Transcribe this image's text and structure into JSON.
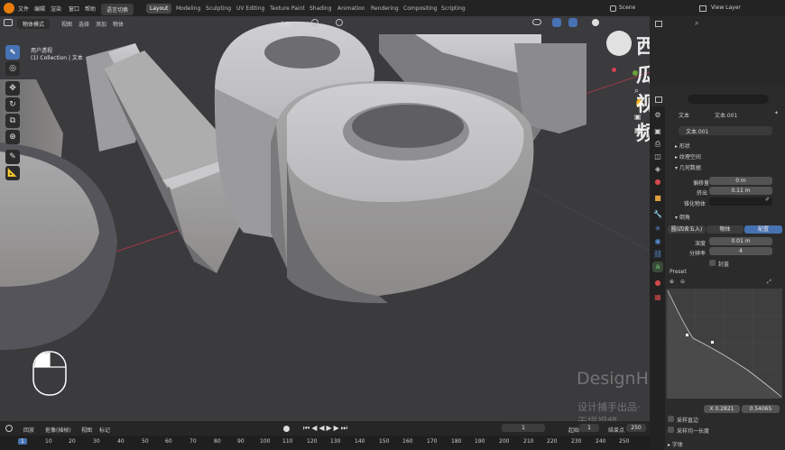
{
  "topbar": {
    "menu": [
      "文件",
      "编辑",
      "渲染",
      "窗口",
      "帮助"
    ],
    "language_button": "语言切换",
    "workspaces": [
      "Layout",
      "Modeling",
      "Sculpting",
      "UV Editing",
      "Texture Paint",
      "Shading",
      "Animation",
      "Rendering",
      "Compositing",
      "Scripting"
    ],
    "active_workspace": "Layout",
    "scene_label": "Scene",
    "view_layer_label": "View Layer"
  },
  "viewport": {
    "mode": "物体模式",
    "menus": [
      "视图",
      "选择",
      "添加",
      "物体"
    ],
    "transform_orientation": "全局",
    "overlay_title": "用户透视",
    "overlay_subtitle": "(1) Collection | 文本",
    "watermark_title": "DesignHunting",
    "watermark_sub": "设计捕手出品·无损视频",
    "logo_text": "西瓜视频",
    "bg_color": "#3b3a3d"
  },
  "timeline": {
    "menus": [
      "回放",
      "抠像(插帧)",
      "视图",
      "标记"
    ],
    "current_frame": "1",
    "start_label": "起始",
    "start_value": "1",
    "end_label": "结束点",
    "end_value": "250",
    "ruler": [
      "1",
      "10",
      "20",
      "30",
      "40",
      "50",
      "60",
      "70",
      "80",
      "90",
      "100",
      "110",
      "120",
      "130",
      "140",
      "150",
      "160",
      "170",
      "180",
      "190",
      "200",
      "210",
      "220",
      "230",
      "240",
      "250"
    ]
  },
  "properties": {
    "object_name": "文本",
    "data_name": "文本.001",
    "datablock": "文本.001",
    "sections": {
      "shape": "形状",
      "texture_space": "纹理空间",
      "geometry": "几何数据",
      "bevel": "倒角",
      "preset": "Preset",
      "font": "字体"
    },
    "offset_label": "偏移量",
    "offset_value": "0 m",
    "extrude_label": "挤出",
    "extrude_value": "0.11 m",
    "taper_label": "锥化物体",
    "bevel_modes": [
      "圆(四舍五入)",
      "物体",
      "配置"
    ],
    "active_bevel_mode": "配置",
    "depth_label": "深度",
    "depth_value": "0.01 m",
    "resolution_label": "分辨率",
    "resolution_value": "4",
    "fill_caps_label": "封盖",
    "curve_x": "X 0.2821",
    "curve_y": "0.54065",
    "sample_straight_label": "采样直边",
    "sample_even_label": "采样均一长度",
    "accent_color": "#4772b3"
  }
}
